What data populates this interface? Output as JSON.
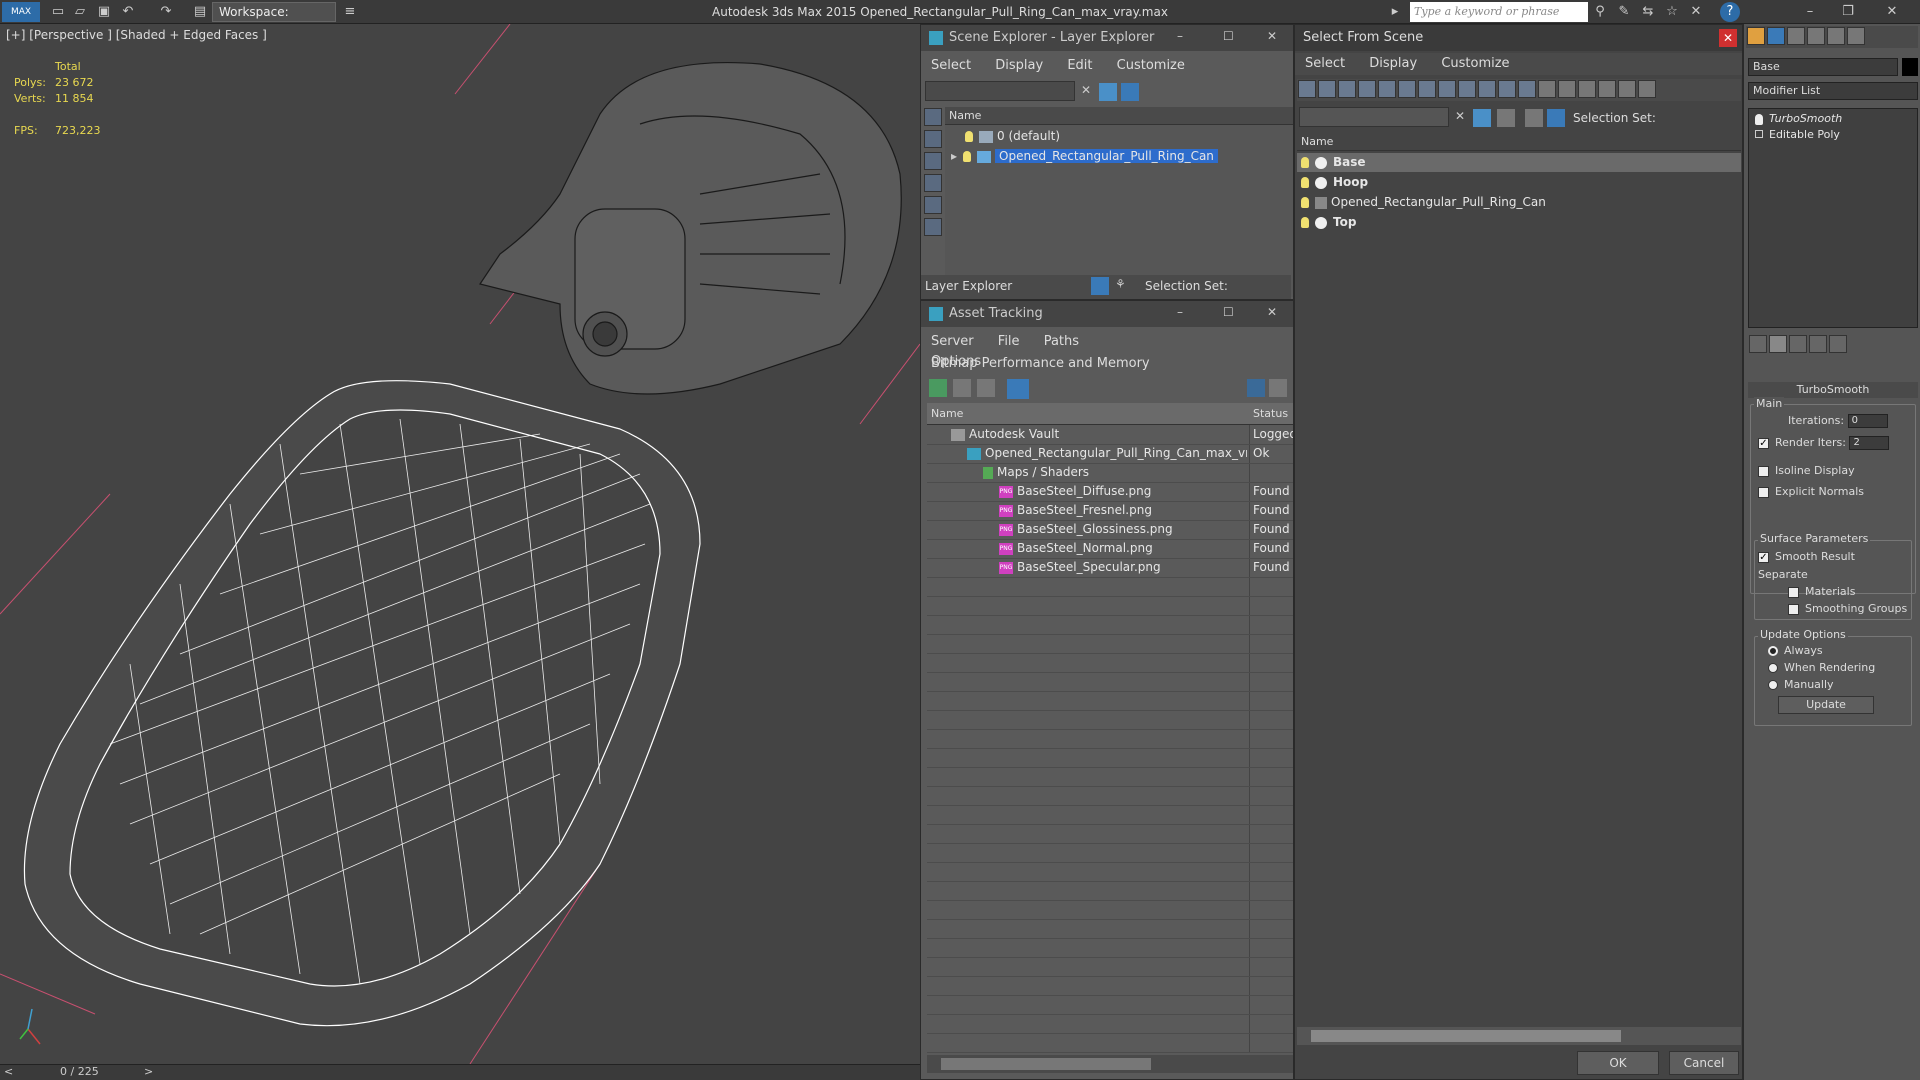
{
  "titlebar": {
    "workspace": "Workspace: Default",
    "app_title": "Autodesk 3ds Max  2015     Opened_Rectangular_Pull_Ring_Can_max_vray.max",
    "search_placeholder": "Type a keyword or phrase"
  },
  "viewport": {
    "label": "[+] [Perspective ] [Shaded + Edged Faces ]",
    "stats": {
      "total_label": "Total",
      "polys_label": "Polys:",
      "polys_value": "23 672",
      "verts_label": "Verts:",
      "verts_value": "11 854",
      "fps_label": "FPS:",
      "fps_value": "723,223"
    }
  },
  "timeline": {
    "frame": "0 / 225",
    "prev": "<",
    "next": ">"
  },
  "scene_explorer": {
    "title": "Scene Explorer - Layer Explorer",
    "menu": [
      "Select",
      "Display",
      "Edit",
      "Customize"
    ],
    "col_name": "Name",
    "rows": [
      "0 (default)",
      "Opened_Rectangular_Pull_Ring_Can"
    ],
    "footer_label": "Layer Explorer",
    "selection_set": "Selection Set:"
  },
  "asset_tracking": {
    "title": "Asset Tracking",
    "menu": [
      "Server",
      "File",
      "Paths",
      "Bitmap Performance and Memory"
    ],
    "menu2": "Options",
    "col_name": "Name",
    "col_status": "Status",
    "rows": [
      {
        "name": "Autodesk Vault",
        "status": "Logged"
      },
      {
        "name": "Opened_Rectangular_Pull_Ring_Can_max_vray....",
        "status": "Ok"
      },
      {
        "name": "Maps / Shaders",
        "status": ""
      },
      {
        "name": "BaseSteel_Diffuse.png",
        "status": "Found"
      },
      {
        "name": "BaseSteel_Fresnel.png",
        "status": "Found"
      },
      {
        "name": "BaseSteel_Glossiness.png",
        "status": "Found"
      },
      {
        "name": "BaseSteel_Normal.png",
        "status": "Found"
      },
      {
        "name": "BaseSteel_Specular.png",
        "status": "Found"
      }
    ]
  },
  "select_from_scene": {
    "title": "Select From Scene",
    "menu": [
      "Select",
      "Display",
      "Customize"
    ],
    "selection_set": "Selection Set:",
    "col_name": "Name",
    "rows": [
      "Base",
      "Hoop",
      "Opened_Rectangular_Pull_Ring_Can",
      "Top"
    ],
    "ok": "OK",
    "cancel": "Cancel"
  },
  "command_panel": {
    "object_name": "Base",
    "modifier_list": "Modifier List",
    "stack": [
      "TurboSmooth",
      "Editable Poly"
    ],
    "rollout_title": "TurboSmooth",
    "main_label": "Main",
    "iterations_label": "Iterations:",
    "iterations_value": "0",
    "render_iters_label": "Render Iters:",
    "render_iters_value": "2",
    "isoline": "Isoline Display",
    "explicit": "Explicit Normals",
    "surface_params": "Surface Parameters",
    "smooth_result": "Smooth Result",
    "separate": "Separate",
    "materials": "Materials",
    "smoothing_groups": "Smoothing Groups",
    "update_options": "Update Options",
    "always": "Always",
    "when_rendering": "When Rendering",
    "manually": "Manually",
    "update_btn": "Update"
  }
}
